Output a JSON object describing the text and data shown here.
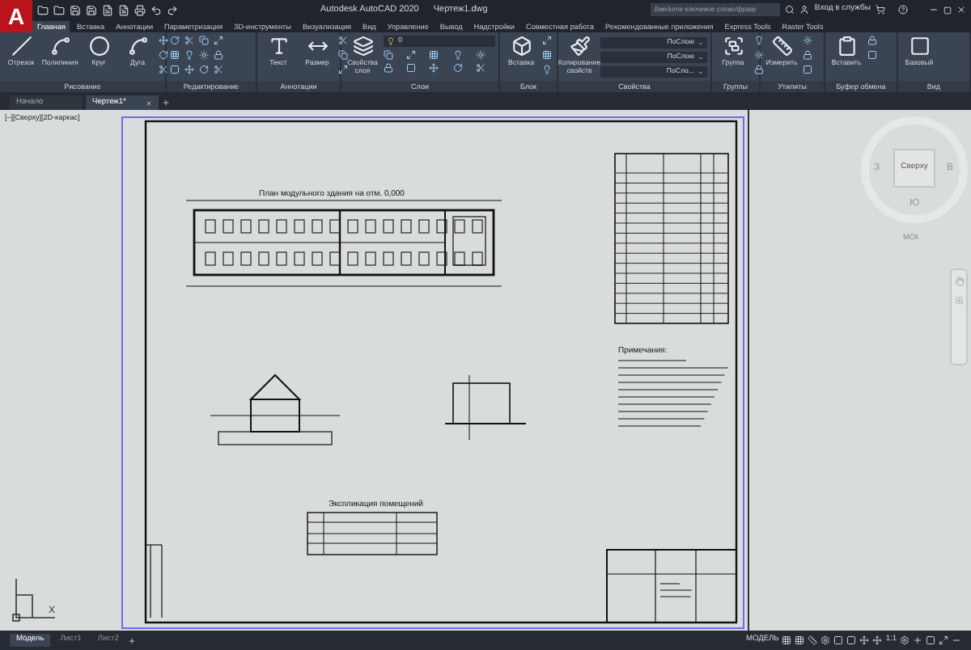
{
  "logo": "A",
  "window": {
    "title": "Autodesk AutoCAD 2020",
    "file": "Чертеж1.dwg"
  },
  "search": {
    "placeholder": "Введите ключевое слово/фразу"
  },
  "sign_in": "Вход в службы",
  "ribbon_tabs": [
    {
      "label": "Главная",
      "selected": true
    },
    {
      "label": "Вставка",
      "selected": false
    },
    {
      "label": "Аннотации",
      "selected": false
    },
    {
      "label": "Параметризация",
      "selected": false
    },
    {
      "label": "3D-инструменты",
      "selected": false
    },
    {
      "label": "Визуализация",
      "selected": false
    },
    {
      "label": "Вид",
      "selected": false
    },
    {
      "label": "Управление",
      "selected": false
    },
    {
      "label": "Вывод",
      "selected": false
    },
    {
      "label": "Надстройки",
      "selected": false
    },
    {
      "label": "Совместная работа",
      "selected": false
    },
    {
      "label": "Рекомендованные приложения",
      "selected": false
    },
    {
      "label": "Express Tools",
      "selected": false
    },
    {
      "label": "Raster Tools",
      "selected": false
    }
  ],
  "ribbon_panels": [
    {
      "title": "Рисование",
      "tools": [
        "Отрезок",
        "Полилиния",
        "Круг",
        "Дуга"
      ]
    },
    {
      "title": "Редактирование"
    },
    {
      "title": "Аннотации",
      "tools": [
        "Текст",
        "Размер"
      ]
    },
    {
      "title": "Слои",
      "tools": [
        "Свойства слоя"
      ],
      "layer": "0"
    },
    {
      "title": "Блок",
      "tools": [
        "Вставка"
      ]
    },
    {
      "title": "Свойства",
      "tools": [
        "Копирование свойств"
      ],
      "dropdowns": [
        "ПоСлою",
        "ПоСлою",
        "ПоСло..."
      ]
    },
    {
      "title": "Группы",
      "tools": [
        "Группа"
      ]
    },
    {
      "title": "Утилиты",
      "tools": [
        "Измерить"
      ]
    },
    {
      "title": "Буфер обмена",
      "tools": [
        "Вставить"
      ]
    },
    {
      "title": "Вид",
      "tools": [
        "Базовый"
      ]
    }
  ],
  "file_tabs": [
    {
      "label": "Начало",
      "selected": false
    },
    {
      "label": "Чертеж1*",
      "selected": true
    }
  ],
  "viewport_label": "[–][Сверху][2D-каркас]",
  "sheet": {
    "plan_title": "План модульного здания на отм. 0,000",
    "schedule_title": "Экспликация помещений",
    "notes_title": "Примечания:"
  },
  "viewcube": {
    "face": "Сверху",
    "west": "З",
    "east": "В",
    "south": "Ю",
    "ucs": "МСК"
  },
  "ucs_x": "X",
  "layout_tabs": [
    {
      "label": "Модель",
      "selected": true
    },
    {
      "label": "Лист1",
      "selected": false
    },
    {
      "label": "Лист2",
      "selected": false
    }
  ],
  "status": {
    "space": "МОДЕЛЬ",
    "scale": "1:1"
  }
}
